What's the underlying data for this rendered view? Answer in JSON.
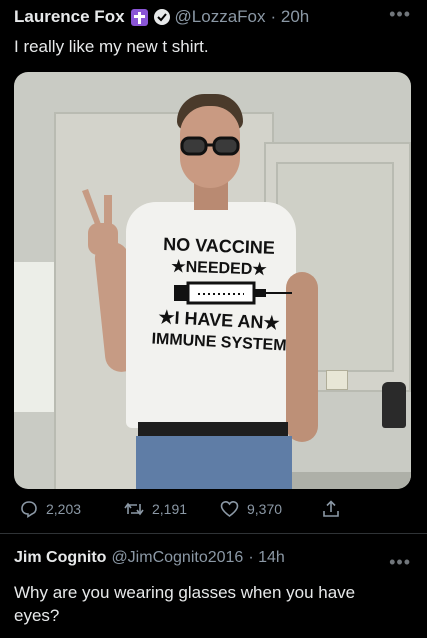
{
  "tweet": {
    "author_name": "Laurence Fox",
    "handle": "@LozzaFox",
    "time": "· 20h",
    "text": "I really like my new t shirt."
  },
  "photo": {
    "shirt_line1": "NO VACCINE",
    "shirt_line2": "★NEEDED★",
    "shirt_line3": "★I HAVE AN★",
    "shirt_line4": "IMMUNE SYSTEM"
  },
  "actions": {
    "replies": "2,203",
    "retweets": "2,191",
    "likes": "9,370"
  },
  "reply": {
    "author_name": "Jim Cognito",
    "handle": "@JimCognito2016",
    "time": "· 14h",
    "text": "Why are you wearing glasses when you have eyes?"
  },
  "icons": {
    "more": "more-icon",
    "reply": "reply-icon",
    "retweet": "retweet-icon",
    "like": "heart-icon",
    "share": "share-icon"
  },
  "colors": {
    "background": "#000000",
    "text": "#e7e9ea",
    "secondary": "#8b98a5",
    "badge": "#8a55d6"
  }
}
